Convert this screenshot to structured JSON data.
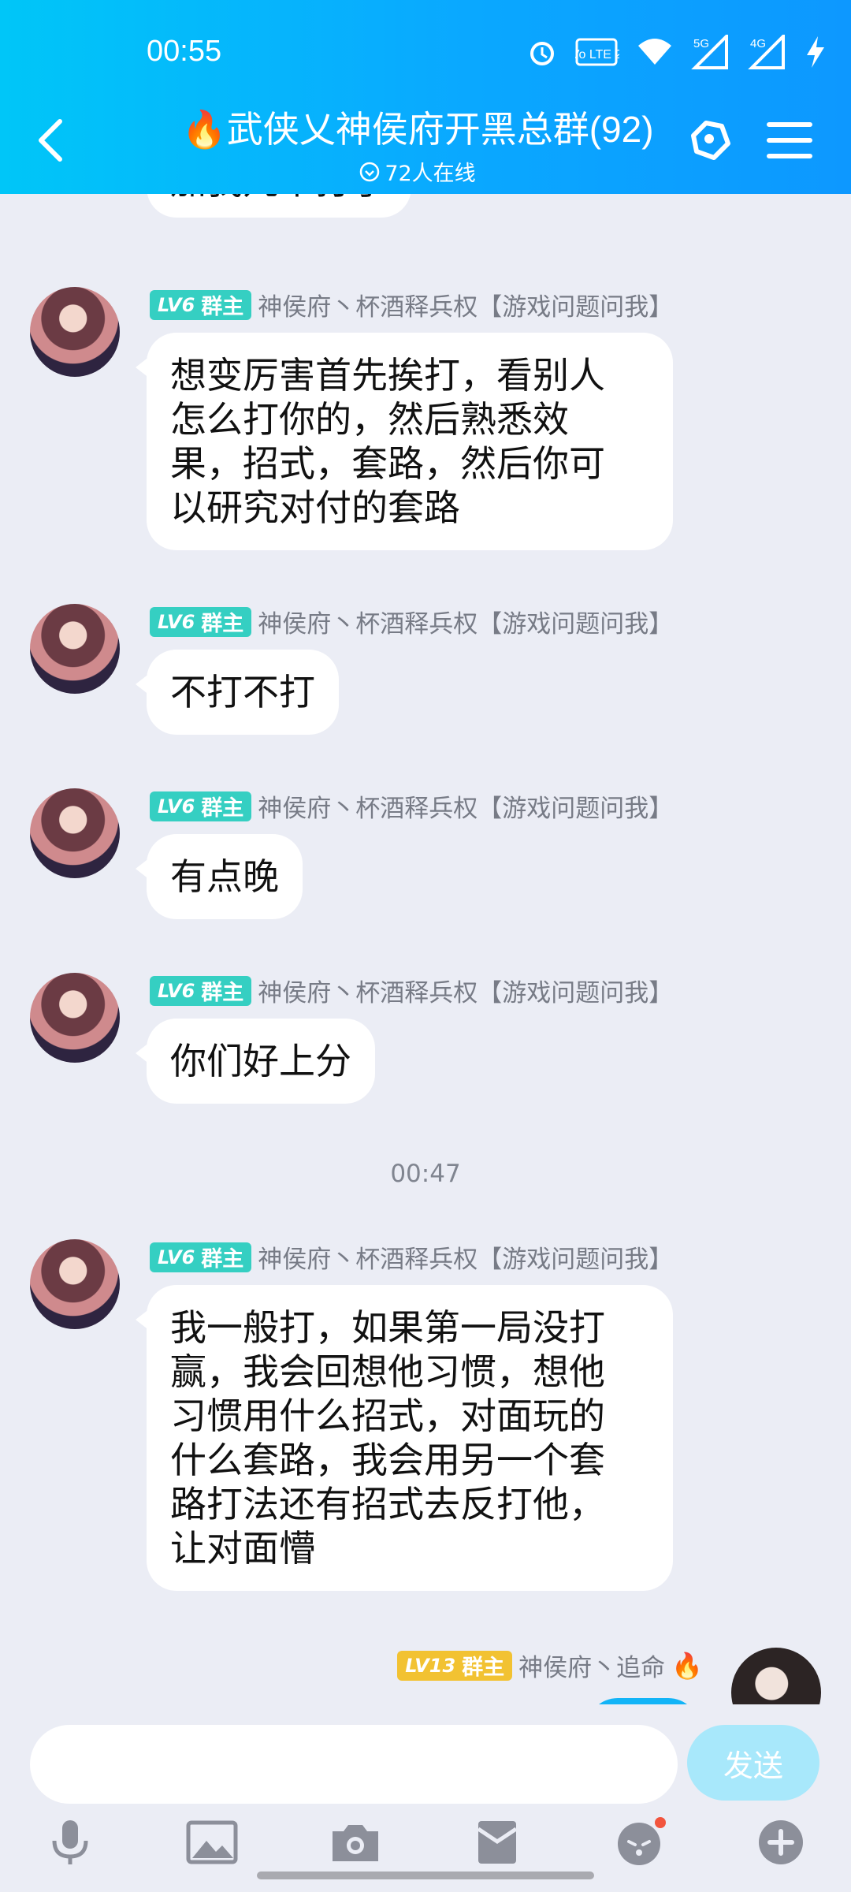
{
  "status": {
    "time": "00:55",
    "network_5g": "5G",
    "network_4g": "4G",
    "volte_label": "Vo LTE 2"
  },
  "header": {
    "title": "🔥武侠乂神侯府开黑总群(92)",
    "online": "72人在线"
  },
  "colors": {
    "header_start": "#00c6f8",
    "header_end": "#0d98ff",
    "badge_teal": "#35cfc2",
    "badge_gold": "#f2c232",
    "send_bg": "#a8e8fb"
  },
  "partial_top_bubble": "加我几个打了",
  "messages": [
    {
      "badge_level": "LV6",
      "badge_role": "群主",
      "nick": "神侯府丶杯酒释兵权【游戏问题问我】",
      "lines": [
        "想变厉害首先挨打，看别人",
        "怎么打你的，然后熟悉效",
        "果，招式，套路，然后你可",
        "以研究对付的套路"
      ]
    },
    {
      "badge_level": "LV6",
      "badge_role": "群主",
      "nick": "神侯府丶杯酒释兵权【游戏问题问我】",
      "lines": [
        "不打不打"
      ]
    },
    {
      "badge_level": "LV6",
      "badge_role": "群主",
      "nick": "神侯府丶杯酒释兵权【游戏问题问我】",
      "lines": [
        "有点晚"
      ]
    },
    {
      "badge_level": "LV6",
      "badge_role": "群主",
      "nick": "神侯府丶杯酒释兵权【游戏问题问我】",
      "lines": [
        "你们好上分"
      ]
    },
    {
      "badge_level": "LV6",
      "badge_role": "群主",
      "nick": "神侯府丶杯酒释兵权【游戏问题问我】",
      "lines": [
        "我一般打，如果第一局没打",
        "赢，我会回想他习惯，想他",
        "习惯用什么招式，对面玩的",
        "什么套路，我会用另一个套",
        "路打法还有招式去反打他，",
        "让对面懵"
      ]
    }
  ],
  "timestamp": "00:47",
  "self_message": {
    "badge_level": "LV13",
    "badge_role": "群主",
    "nick": "神侯府丶追命",
    "nick_icon": "🔥"
  },
  "composer": {
    "send_label": "发送"
  },
  "toolbar": {
    "icons": [
      "microphone-icon",
      "image-icon",
      "camera-icon",
      "red-packet-icon",
      "emoji-icon",
      "plus-icon"
    ]
  }
}
